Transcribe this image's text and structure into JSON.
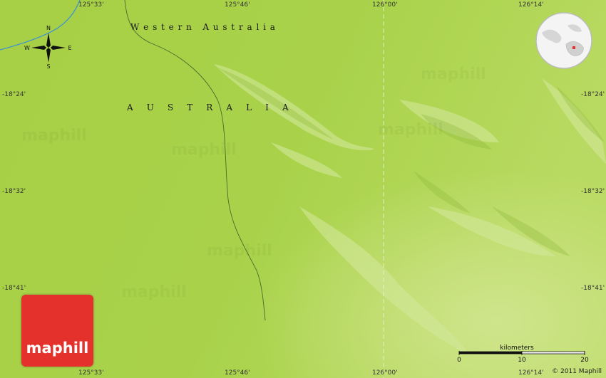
{
  "map": {
    "top_coords": [
      "125°33'",
      "125°46'",
      "126°00'",
      "126°14'"
    ],
    "bottom_coords": [
      "125°33'",
      "125°46'",
      "126°00'",
      "126°14'"
    ],
    "left_coords": [
      "-18°24'",
      "-18°32'",
      "-18°41'"
    ],
    "right_coords": [
      "-18°24'",
      "-18°32'",
      "-18°41'"
    ],
    "region_label": "W e s t e r n   A u s t r a l i a",
    "country_label": "A     U     S     T     R     A     L     I     A",
    "compass": {
      "n": "N",
      "s": "S",
      "e": "E",
      "w": "W"
    },
    "watermark": "maphill",
    "logo_text": "maphill",
    "scale": {
      "unit": "kilometers",
      "ticks": [
        "0",
        "10",
        "20"
      ]
    },
    "copyright": "© 2011 Maphill",
    "colors": {
      "land": "#a9d24a",
      "land_light": "#c7e07a",
      "river": "#3a8fd8",
      "logo": "#e4312b"
    }
  }
}
